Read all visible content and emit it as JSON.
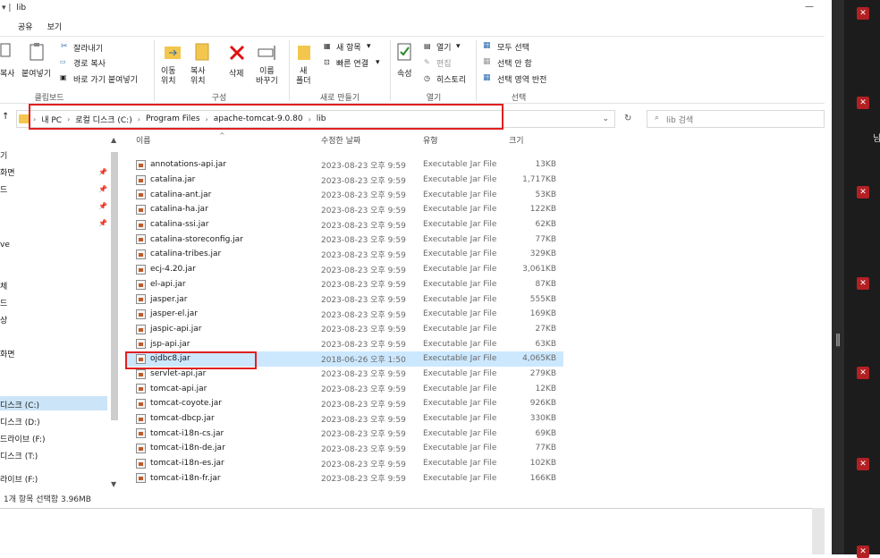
{
  "window": {
    "title": "lib",
    "title_icons": "▾ |"
  },
  "menu": {
    "tabs": [
      "공유",
      "보기"
    ]
  },
  "ribbon": {
    "clipboard": {
      "copy": "복사",
      "paste": "붙여넣기",
      "cut": "잘라내기",
      "copy_path": "경로 복사",
      "paste_shortcut": "바로 가기 붙여넣기",
      "group": "클립보드"
    },
    "organize": {
      "move_to": "이동\n위치",
      "copy_to": "복사\n위치",
      "delete": "삭제",
      "rename": "이름\n바꾸기",
      "group": "구성"
    },
    "new": {
      "new_folder": "새\n폴더",
      "new_item": "새 항목",
      "easy_access": "빠른 연결",
      "group": "새로 만들기"
    },
    "open": {
      "properties": "속성",
      "open": "열기",
      "edit": "편집",
      "history": "히스토리",
      "group": "열기"
    },
    "select": {
      "select_all": "모두 선택",
      "select_none": "선택 안 함",
      "invert": "선택 영역 반전",
      "group": "선택"
    }
  },
  "address": {
    "segments": [
      "내 PC",
      "로컬 디스크 (C:)",
      "Program Files",
      "apache-tomcat-9.0.80",
      "lib"
    ],
    "search_placeholder": "lib 검색"
  },
  "nav": {
    "items": [
      "기",
      "화면",
      "드",
      "ve",
      "체",
      "드",
      "상",
      "화면",
      "디스크 (C:)",
      "디스크 (D:)",
      "드라이브 (F:)",
      "디스크 (T:)",
      "라이브 (F:)"
    ]
  },
  "columns": {
    "name": "이름",
    "modified": "수정한 날짜",
    "type": "유형",
    "size": "크기"
  },
  "files": [
    {
      "name": "annotations-api.jar",
      "date": "2023-08-23 오후 9:59",
      "type": "Executable Jar File",
      "size": "13KB"
    },
    {
      "name": "catalina.jar",
      "date": "2023-08-23 오후 9:59",
      "type": "Executable Jar File",
      "size": "1,717KB"
    },
    {
      "name": "catalina-ant.jar",
      "date": "2023-08-23 오후 9:59",
      "type": "Executable Jar File",
      "size": "53KB"
    },
    {
      "name": "catalina-ha.jar",
      "date": "2023-08-23 오후 9:59",
      "type": "Executable Jar File",
      "size": "122KB"
    },
    {
      "name": "catalina-ssi.jar",
      "date": "2023-08-23 오후 9:59",
      "type": "Executable Jar File",
      "size": "62KB"
    },
    {
      "name": "catalina-storeconfig.jar",
      "date": "2023-08-23 오후 9:59",
      "type": "Executable Jar File",
      "size": "77KB"
    },
    {
      "name": "catalina-tribes.jar",
      "date": "2023-08-23 오후 9:59",
      "type": "Executable Jar File",
      "size": "329KB"
    },
    {
      "name": "ecj-4.20.jar",
      "date": "2023-08-23 오후 9:59",
      "type": "Executable Jar File",
      "size": "3,061KB"
    },
    {
      "name": "el-api.jar",
      "date": "2023-08-23 오후 9:59",
      "type": "Executable Jar File",
      "size": "87KB"
    },
    {
      "name": "jasper.jar",
      "date": "2023-08-23 오후 9:59",
      "type": "Executable Jar File",
      "size": "555KB"
    },
    {
      "name": "jasper-el.jar",
      "date": "2023-08-23 오후 9:59",
      "type": "Executable Jar File",
      "size": "169KB"
    },
    {
      "name": "jaspic-api.jar",
      "date": "2023-08-23 오후 9:59",
      "type": "Executable Jar File",
      "size": "27KB"
    },
    {
      "name": "jsp-api.jar",
      "date": "2023-08-23 오후 9:59",
      "type": "Executable Jar File",
      "size": "63KB"
    },
    {
      "name": "ojdbc8.jar",
      "date": "2018-06-26 오후 1:50",
      "type": "Executable Jar File",
      "size": "4,065KB",
      "selected": true
    },
    {
      "name": "servlet-api.jar",
      "date": "2023-08-23 오후 9:59",
      "type": "Executable Jar File",
      "size": "279KB"
    },
    {
      "name": "tomcat-api.jar",
      "date": "2023-08-23 오후 9:59",
      "type": "Executable Jar File",
      "size": "12KB"
    },
    {
      "name": "tomcat-coyote.jar",
      "date": "2023-08-23 오후 9:59",
      "type": "Executable Jar File",
      "size": "926KB"
    },
    {
      "name": "tomcat-dbcp.jar",
      "date": "2023-08-23 오후 9:59",
      "type": "Executable Jar File",
      "size": "330KB"
    },
    {
      "name": "tomcat-i18n-cs.jar",
      "date": "2023-08-23 오후 9:59",
      "type": "Executable Jar File",
      "size": "69KB"
    },
    {
      "name": "tomcat-i18n-de.jar",
      "date": "2023-08-23 오후 9:59",
      "type": "Executable Jar File",
      "size": "77KB"
    },
    {
      "name": "tomcat-i18n-es.jar",
      "date": "2023-08-23 오후 9:59",
      "type": "Executable Jar File",
      "size": "102KB"
    },
    {
      "name": "tomcat-i18n-fr.jar",
      "date": "2023-08-23 오후 9:59",
      "type": "Executable Jar File",
      "size": "166KB"
    }
  ],
  "status": {
    "text": "1개 항목 선택함 3.96MB"
  },
  "side_panel": {
    "label": "님"
  },
  "colors": {
    "highlight": "#e02020",
    "selection": "#cce8ff",
    "nav_selection": "#cce4f7"
  }
}
